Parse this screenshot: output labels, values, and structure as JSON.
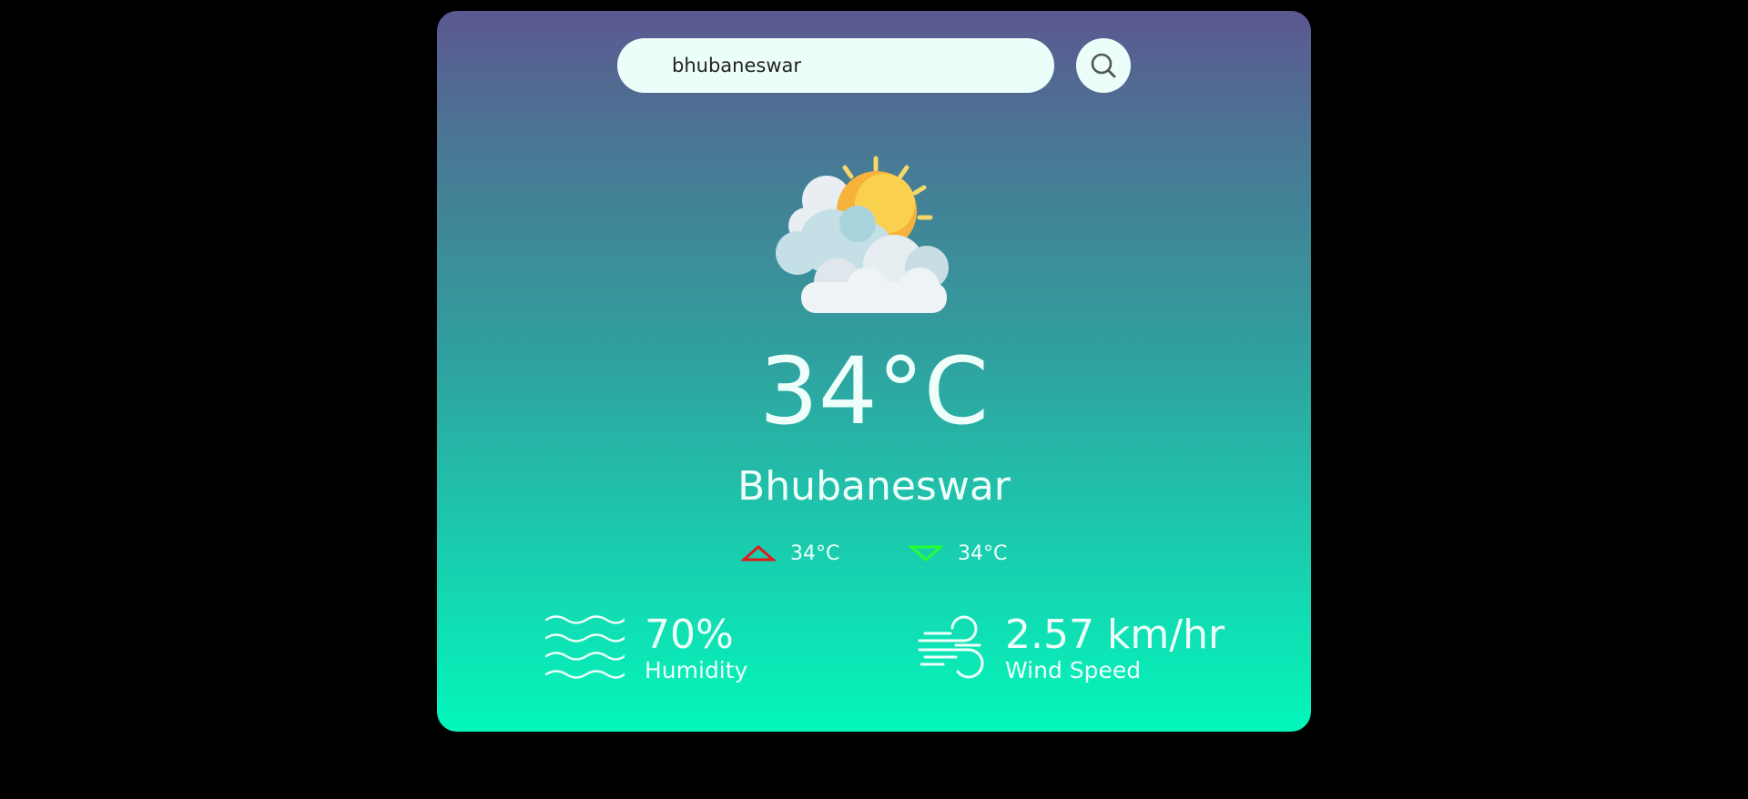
{
  "search": {
    "value": "bhubaneswar",
    "button_icon": "search-icon"
  },
  "weather": {
    "icon": "partly-cloudy-icon",
    "temperature": "34°C",
    "city": "Bhubaneswar",
    "max_temp": "34°C",
    "min_temp": "34°C",
    "max_icon": "triangle-up-icon",
    "min_icon": "triangle-down-icon"
  },
  "details": {
    "humidity_value": "70%",
    "humidity_label": "Humidity",
    "humidity_icon": "waves-icon",
    "wind_value": "2.57 km/hr",
    "wind_label": "Wind Speed",
    "wind_icon": "wind-icon"
  },
  "colors": {
    "gradient_top": "#5c5890",
    "gradient_bottom": "#03f7bb",
    "max_indicator": "#e31a1a",
    "min_indicator": "#22ff33",
    "page_background": "#000000"
  }
}
